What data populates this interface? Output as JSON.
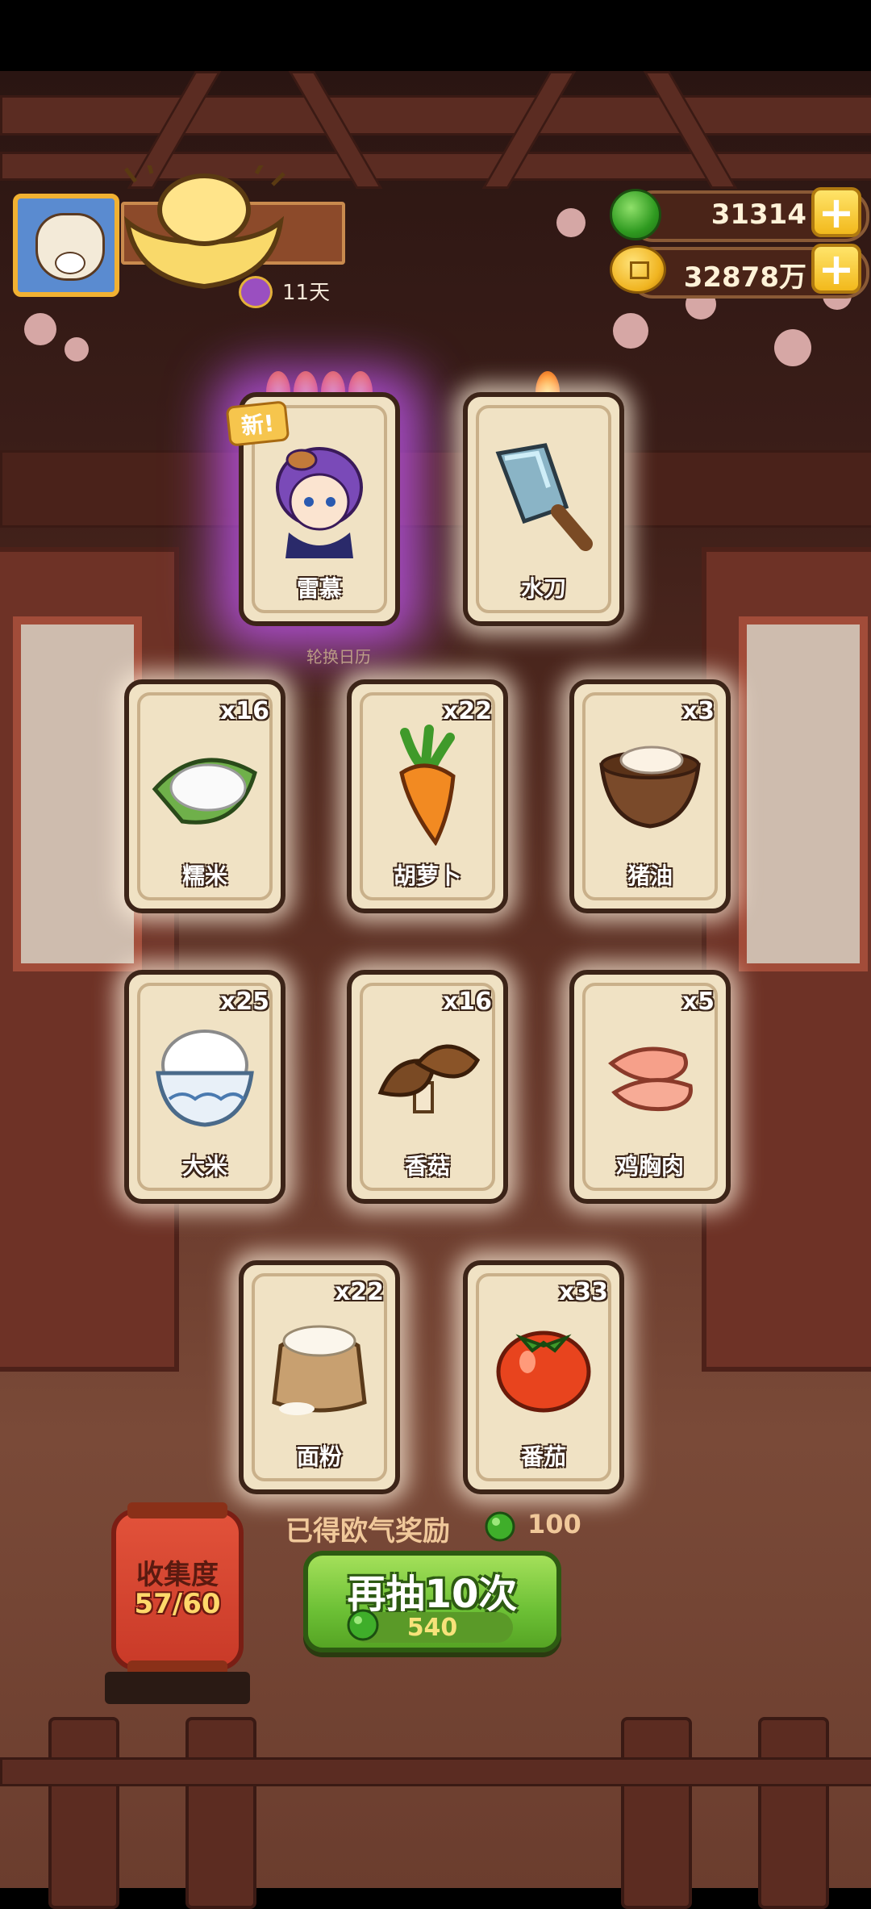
{
  "header": {
    "days_label": "11天"
  },
  "currencies": [
    {
      "name": "jade",
      "value": "31314",
      "plus": "+"
    },
    {
      "name": "coin",
      "value": "32878万",
      "plus": "+"
    }
  ],
  "featured_cards": [
    {
      "label": "雷慕",
      "flames": 4,
      "badge": "新!",
      "art": "purple-haired-character"
    },
    {
      "label": "水刀",
      "flames": 1,
      "art": "cleaver-knife"
    }
  ],
  "rotation_label": "轮换日历",
  "cards": [
    {
      "label": "糯米",
      "count": "x16",
      "art": "sticky-rice"
    },
    {
      "label": "胡萝卜",
      "count": "x22",
      "art": "carrot"
    },
    {
      "label": "猪油",
      "count": "x3",
      "art": "lard-bowl"
    },
    {
      "label": "大米",
      "count": "x25",
      "art": "rice-bowl"
    },
    {
      "label": "香菇",
      "count": "x16",
      "art": "shiitake"
    },
    {
      "label": "鸡胸肉",
      "count": "x5",
      "art": "chicken-breast"
    },
    {
      "label": "面粉",
      "count": "x22",
      "art": "flour-sack"
    },
    {
      "label": "番茄",
      "count": "x33",
      "art": "tomato"
    }
  ],
  "collection": {
    "title": "收集度",
    "value": "57/60"
  },
  "luck_reward": {
    "label": "已得欧气奖励",
    "value": "100"
  },
  "draw_button": {
    "label": "再抽10次",
    "cost": "540"
  },
  "colors": {
    "jade": "#2f9a20",
    "gold": "#f2b91c",
    "card_bg": "#f0e2c4",
    "draw_green": "#6cc035",
    "lantern_red": "#c93a28"
  }
}
